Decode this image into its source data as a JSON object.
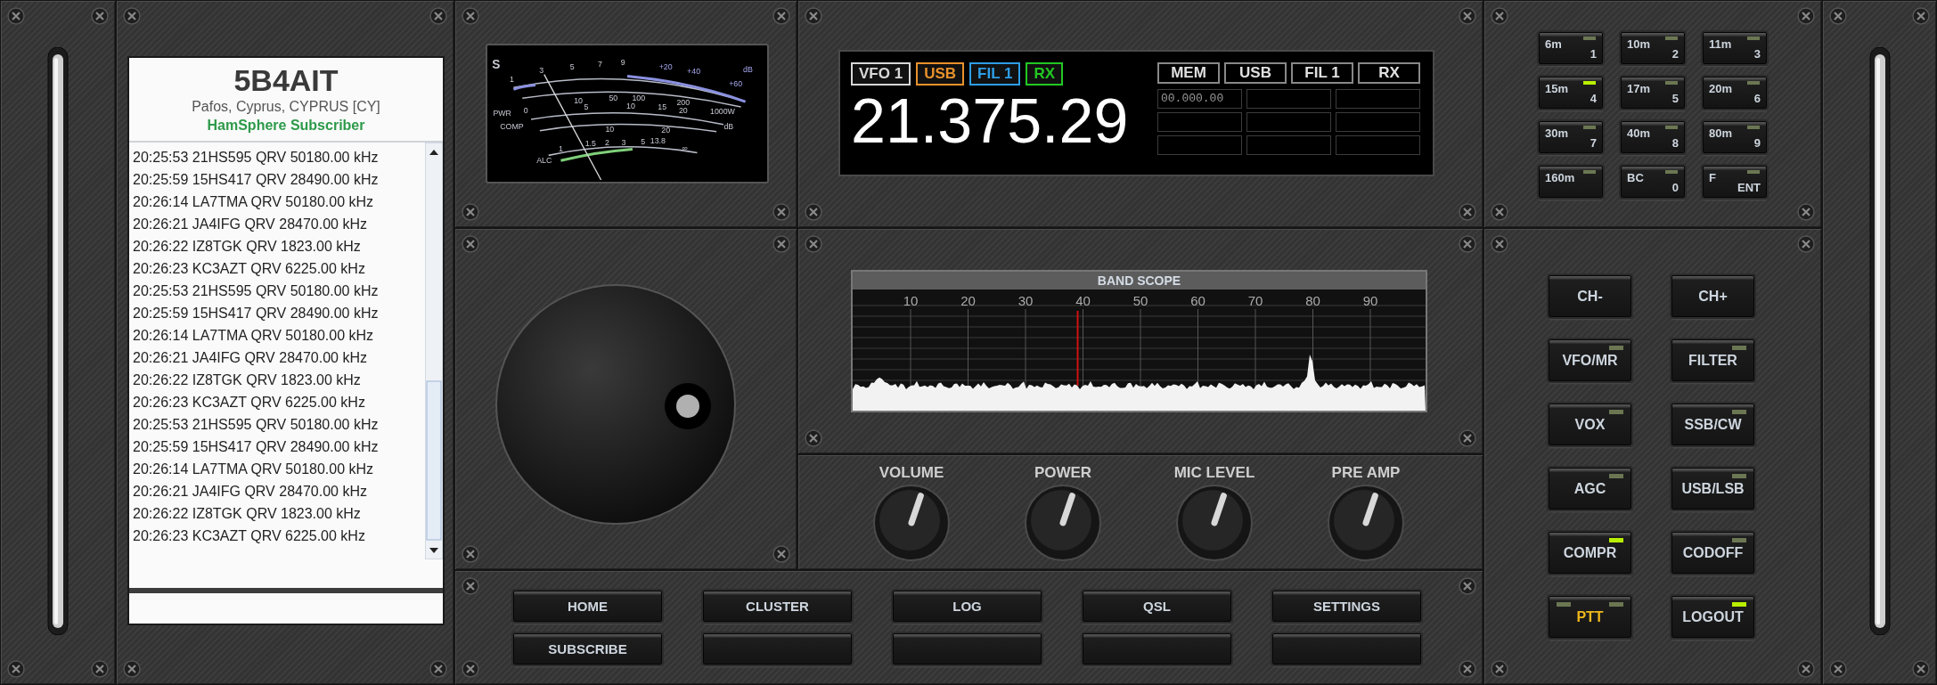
{
  "log_panel": {
    "callsign": "5B4AIT",
    "location": "Pafos, Cyprus, CYPRUS [CY]",
    "status": "HamSphere Subscriber",
    "entries": [
      "20:25:53 21HS595 QRV 50180.00 kHz",
      "20:25:59 15HS417 QRV 28490.00 kHz",
      "20:26:14 LA7TMA QRV 50180.00 kHz",
      "20:26:21 JA4IFG QRV 28470.00 kHz",
      "20:26:22 IZ8TGK QRV 1823.00 kHz",
      "20:26:23 KC3AZT QRV 6225.00 kHz",
      "20:25:53 21HS595 QRV 50180.00 kHz",
      "20:25:59 15HS417 QRV 28490.00 kHz",
      "20:26:14 LA7TMA QRV 50180.00 kHz",
      "20:26:21 JA4IFG QRV 28470.00 kHz",
      "20:26:22 IZ8TGK QRV 1823.00 kHz",
      "20:26:23 KC3AZT QRV 6225.00 kHz",
      "20:25:53 21HS595 QRV 50180.00 kHz",
      "20:25:59 15HS417 QRV 28490.00 kHz",
      "20:26:14 LA7TMA QRV 50180.00 kHz",
      "20:26:21 JA4IFG QRV 28470.00 kHz",
      "20:26:22 IZ8TGK QRV 1823.00 kHz",
      "20:26:23 KC3AZT QRV 6225.00 kHz"
    ]
  },
  "meter": {
    "scale_labels": [
      "S",
      "1",
      "3",
      "5",
      "7",
      "9",
      "+20",
      "+40",
      "dB",
      "+60",
      "10",
      "50",
      "100",
      "200",
      "PWR",
      "0",
      "5",
      "10",
      "15",
      "20",
      "1000W",
      "COMP",
      "10",
      "20",
      "dB",
      "ALC",
      "1",
      "1.5",
      "2",
      "3",
      "5",
      "13.8",
      "∞"
    ]
  },
  "display": {
    "tags": [
      {
        "label": "VFO 1",
        "color": "#d8d8d8"
      },
      {
        "label": "USB",
        "color": "#e8922c"
      },
      {
        "label": "FIL 1",
        "color": "#2e9ee6"
      },
      {
        "label": "RX",
        "color": "#22c922"
      }
    ],
    "frequency": "21.375.29",
    "memory": {
      "headers": [
        "MEM",
        "USB",
        "FIL 1",
        "RX"
      ],
      "value": "00.000.00"
    }
  },
  "keypad": {
    "keys": [
      {
        "band": "6m",
        "digit": "1",
        "lit": false
      },
      {
        "band": "10m",
        "digit": "2",
        "lit": false
      },
      {
        "band": "11m",
        "digit": "3",
        "lit": false
      },
      {
        "band": "15m",
        "digit": "4",
        "lit": true
      },
      {
        "band": "17m",
        "digit": "5",
        "lit": false
      },
      {
        "band": "20m",
        "digit": "6",
        "lit": false
      },
      {
        "band": "30m",
        "digit": "7",
        "lit": false
      },
      {
        "band": "40m",
        "digit": "8",
        "lit": false
      },
      {
        "band": "80m",
        "digit": "9",
        "lit": false
      },
      {
        "band": "160m",
        "lit": false
      },
      {
        "band": "BC",
        "digit": "0",
        "lit": false
      },
      {
        "band": "F",
        "digit": "ENT",
        "lit": false
      }
    ]
  },
  "band_scope": {
    "title": "BAND SCOPE",
    "scale": [
      "10",
      "20",
      "30",
      "40",
      "50",
      "60",
      "70",
      "80",
      "90"
    ]
  },
  "knobs": [
    {
      "label": "VOLUME",
      "level": 0.57
    },
    {
      "label": "POWER",
      "level": 0.57
    },
    {
      "label": "MIC LEVEL",
      "level": 0.57
    },
    {
      "label": "PRE AMP",
      "level": 0.57
    }
  ],
  "function_buttons": [
    {
      "label": "CH-",
      "kind": "plain"
    },
    {
      "label": "CH+",
      "kind": "plain"
    },
    {
      "label": "VFO/MR",
      "kind": "led",
      "lit": false
    },
    {
      "label": "FILTER",
      "kind": "led",
      "lit": false
    },
    {
      "label": "VOX",
      "kind": "led",
      "lit": false
    },
    {
      "label": "SSB/CW",
      "kind": "led",
      "lit": false
    },
    {
      "label": "AGC",
      "kind": "led",
      "lit": false
    },
    {
      "label": "USB/LSB",
      "kind": "led",
      "lit": false
    },
    {
      "label": "COMPR",
      "kind": "led",
      "lit": true
    },
    {
      "label": "CODOFF",
      "kind": "led",
      "lit": false
    },
    {
      "label": "PTT",
      "kind": "ptt",
      "lit": false
    },
    {
      "label": "LOGOUT",
      "kind": "led",
      "lit": true
    }
  ],
  "nav_buttons": [
    "HOME",
    "CLUSTER",
    "LOG",
    "QSL",
    "SETTINGS",
    "SUBSCRIBE"
  ]
}
